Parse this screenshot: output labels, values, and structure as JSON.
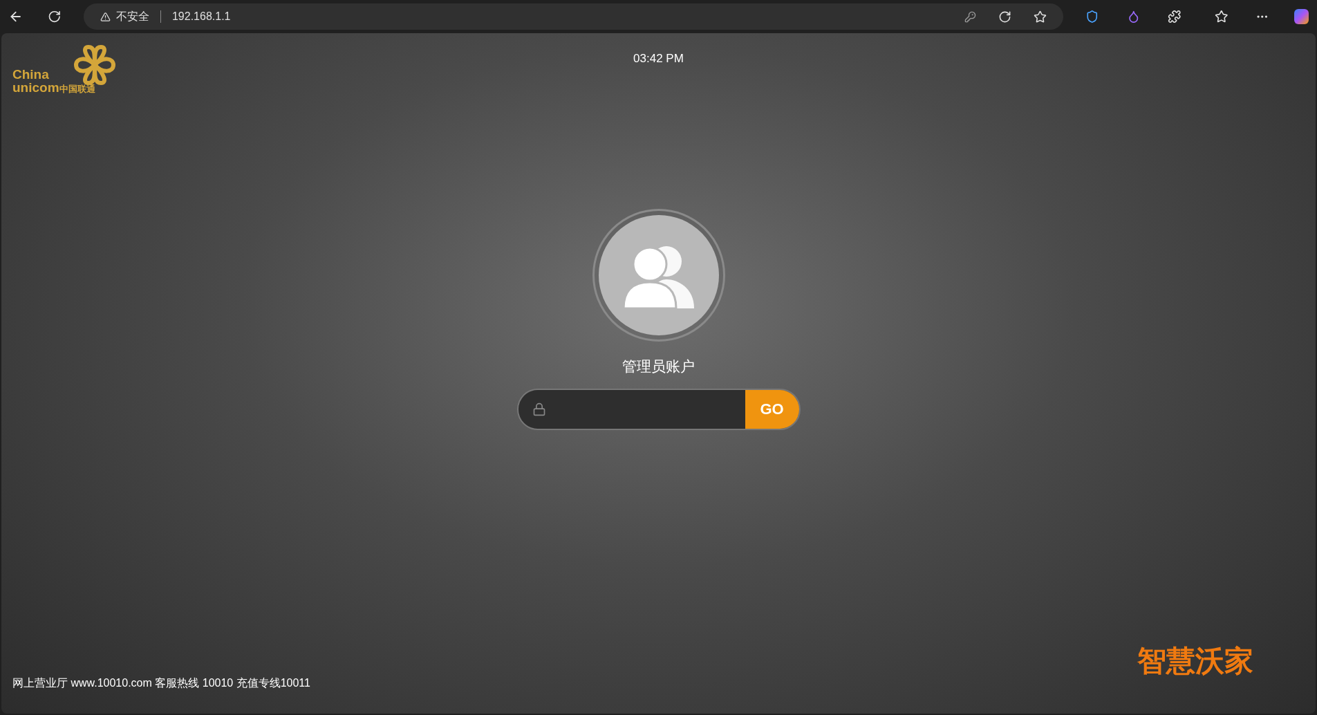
{
  "browser": {
    "security_label": "不安全",
    "url": "192.168.1.1"
  },
  "page": {
    "logo": {
      "line1": "China",
      "line2": "unicom",
      "line2_cn": "中国联通"
    },
    "time": "03:42 PM",
    "account_label": "管理员账户",
    "go_button": "GO",
    "footer": "网上营业厅 www.10010.com 客服热线 10010 充值专线10011",
    "brand": "智慧沃家"
  }
}
